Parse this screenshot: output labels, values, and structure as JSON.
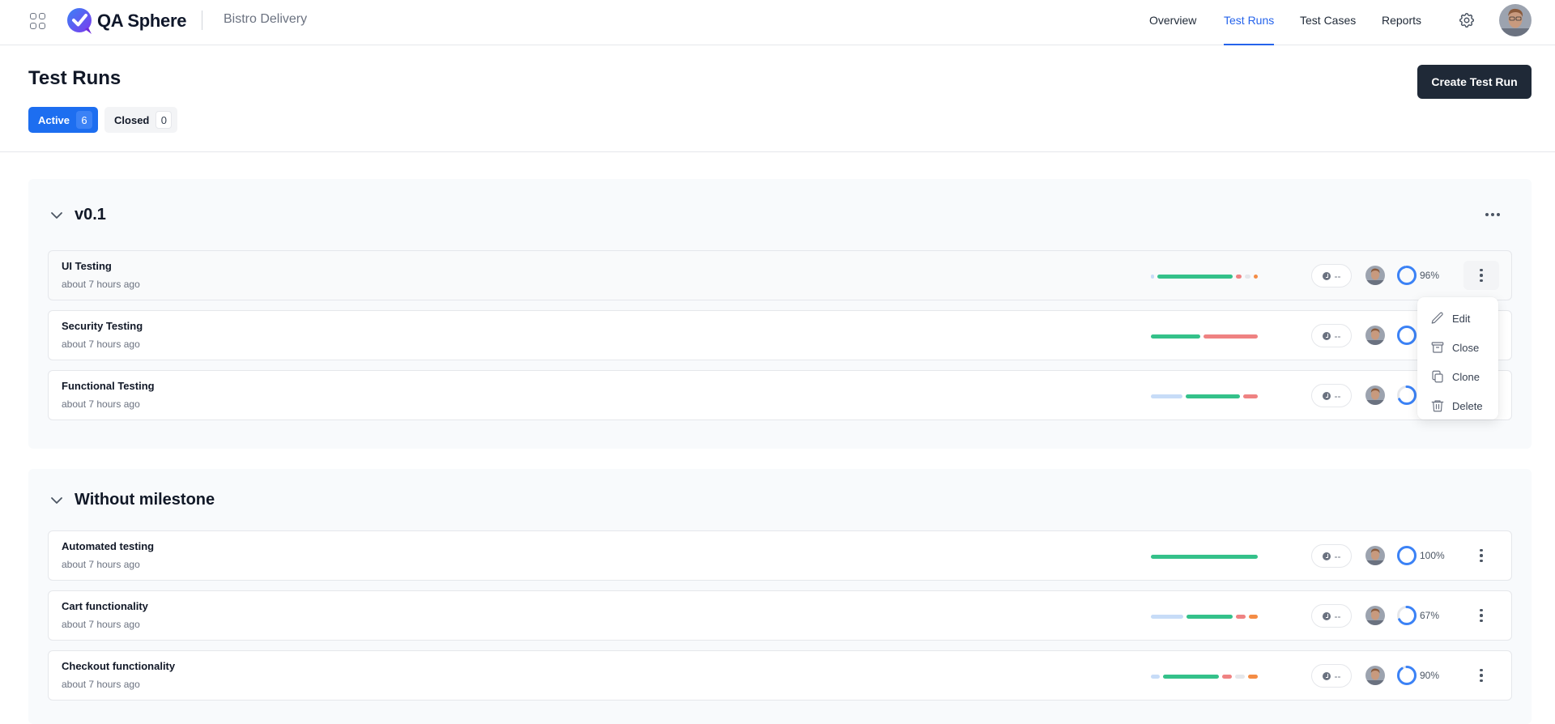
{
  "app": {
    "brand": "QA Sphere",
    "project": "Bistro Delivery"
  },
  "nav": {
    "items": [
      {
        "label": "Overview",
        "active": false
      },
      {
        "label": "Test Runs",
        "active": true
      },
      {
        "label": "Test Cases",
        "active": false
      },
      {
        "label": "Reports",
        "active": false
      }
    ]
  },
  "page": {
    "title": "Test Runs",
    "create_label": "Create Test Run",
    "tabs": [
      {
        "label": "Active",
        "count": "6",
        "active": true
      },
      {
        "label": "Closed",
        "count": "0",
        "active": false
      }
    ]
  },
  "colors": {
    "accent": "#2563eb",
    "passed": "#34c18a",
    "failed": "#ef8282",
    "open": "#c7dcf7",
    "skipped": "#e5e7eb",
    "blocked": "#f48c45",
    "progress": "#3b82f6"
  },
  "groups": [
    {
      "title": "v0.1",
      "runs": [
        {
          "name": "UI Testing",
          "time": "about 7 hours ago",
          "duration": "--",
          "progress": "96%",
          "progress_value": 96,
          "segments": [
            {
              "status": "open",
              "weight": 2
            },
            {
              "status": "passed",
              "weight": 70
            },
            {
              "status": "failed",
              "weight": 5
            },
            {
              "status": "skipped",
              "weight": 5
            },
            {
              "status": "blocked",
              "weight": 4
            }
          ]
        },
        {
          "name": "Security Testing",
          "time": "about 7 hours ago",
          "duration": "--",
          "progress": "",
          "progress_value": 100,
          "segments": [
            {
              "status": "passed",
              "weight": 48
            },
            {
              "status": "failed",
              "weight": 52
            }
          ]
        },
        {
          "name": "Functional Testing",
          "time": "about 7 hours ago",
          "duration": "--",
          "progress": "",
          "progress_value": 67,
          "segments": [
            {
              "status": "open",
              "weight": 30
            },
            {
              "status": "passed",
              "weight": 52
            },
            {
              "status": "failed",
              "weight": 14
            }
          ]
        }
      ]
    },
    {
      "title": "Without milestone",
      "runs": [
        {
          "name": "Automated testing",
          "time": "about 7 hours ago",
          "duration": "--",
          "progress": "100%",
          "progress_value": 100,
          "segments": [
            {
              "status": "passed",
              "weight": 100
            }
          ]
        },
        {
          "name": "Cart functionality",
          "time": "about 7 hours ago",
          "duration": "--",
          "progress": "67%",
          "progress_value": 67,
          "segments": [
            {
              "status": "open",
              "weight": 30
            },
            {
              "status": "passed",
              "weight": 42
            },
            {
              "status": "failed",
              "weight": 9
            },
            {
              "status": "blocked",
              "weight": 8
            }
          ]
        },
        {
          "name": "Checkout functionality",
          "time": "about 7 hours ago",
          "duration": "--",
          "progress": "90%",
          "progress_value": 90,
          "segments": [
            {
              "status": "open",
              "weight": 8
            },
            {
              "status": "passed",
              "weight": 53
            },
            {
              "status": "failed",
              "weight": 9
            },
            {
              "status": "skipped",
              "weight": 9
            },
            {
              "status": "blocked",
              "weight": 9
            }
          ]
        }
      ]
    }
  ],
  "context_menu": {
    "items": [
      {
        "label": "Edit",
        "icon": "pencil-icon"
      },
      {
        "label": "Close",
        "icon": "archive-icon"
      },
      {
        "label": "Clone",
        "icon": "copy-icon"
      },
      {
        "label": "Delete",
        "icon": "trash-icon"
      }
    ]
  }
}
